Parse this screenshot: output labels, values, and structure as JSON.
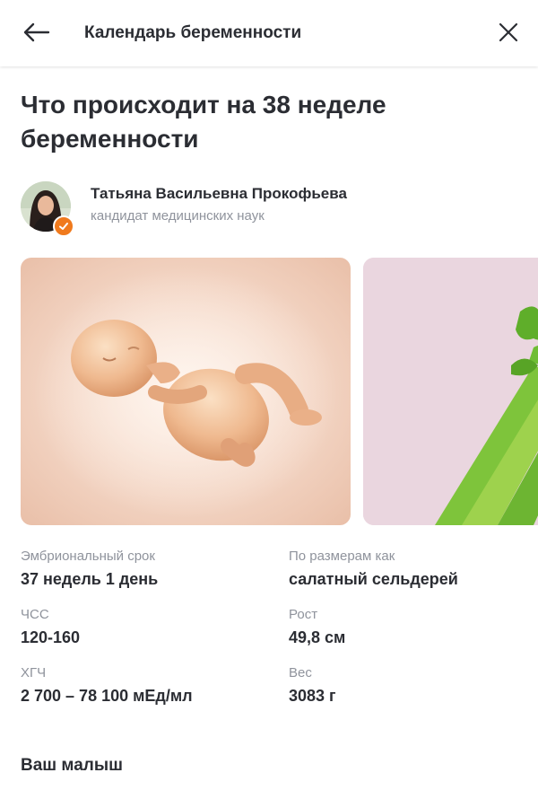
{
  "header": {
    "title": "Календарь беременности",
    "back_icon": "arrow-left-icon",
    "close_icon": "close-icon"
  },
  "article": {
    "title": "Что происходит на 38 неделе беременности"
  },
  "author": {
    "name": "Татьяна Васильевна Прокофьева",
    "role": "кандидат медицинских наук",
    "badge_icon": "verified-check-icon",
    "badge_color": "#f07a1d"
  },
  "carousel": {
    "items": [
      "fetus-illustration",
      "celery-photo"
    ]
  },
  "stats": {
    "embryo_term": {
      "label": "Эмбриональный срок",
      "value": "37 недель 1 день"
    },
    "size_like": {
      "label": "По размерам как",
      "value": "салатный сельдерей"
    },
    "heart_rate": {
      "label": "ЧСС",
      "value": "120-160"
    },
    "height": {
      "label": "Рост",
      "value": "49,8 см"
    },
    "hcg": {
      "label": "ХГЧ",
      "value": "2 700 – 78 100 мЕд/мл"
    },
    "weight": {
      "label": "Вес",
      "value": "3083 г"
    }
  },
  "section": {
    "title": "Ваш малыш"
  }
}
